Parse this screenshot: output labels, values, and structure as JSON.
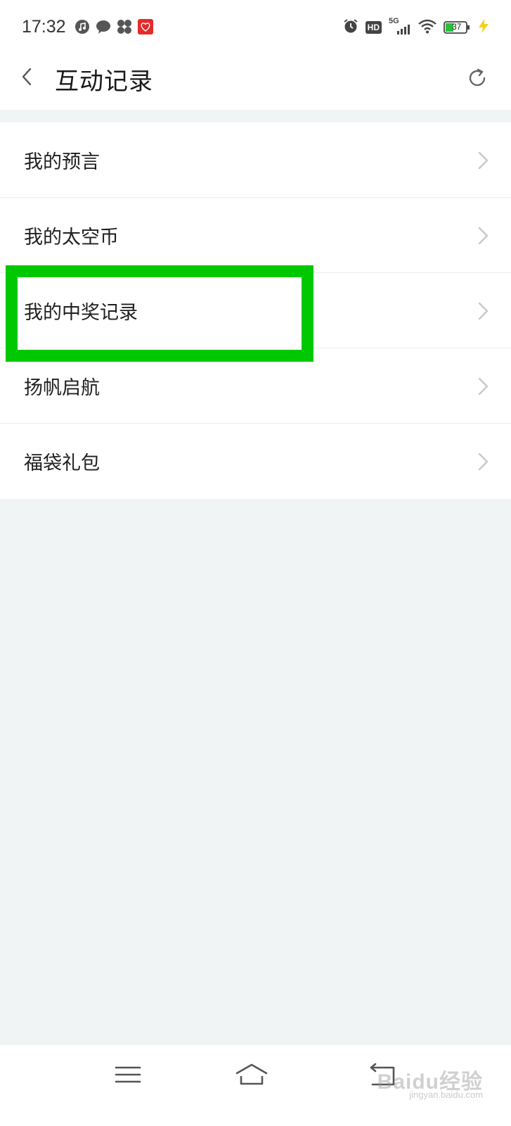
{
  "status_bar": {
    "time": "17:32",
    "notifications": [
      "music-icon",
      "chat-icon",
      "fan-icon",
      "taobao-icon"
    ],
    "system": {
      "alarm": "alarm-icon",
      "hd": "HD",
      "network": "5G",
      "battery_level": "37",
      "charging": true
    }
  },
  "header": {
    "back_icon": "chevron-left-icon",
    "title": "互动记录",
    "refresh_icon": "refresh-icon"
  },
  "menu": {
    "items": [
      {
        "label": "我的预言"
      },
      {
        "label": "我的太空币"
      },
      {
        "label": "我的中奖记录"
      },
      {
        "label": "扬帆启航"
      },
      {
        "label": "福袋礼包"
      }
    ]
  },
  "highlight": {
    "color": "#00c800",
    "target": "我的中奖记录"
  },
  "nav_bar": {
    "menu_icon": "hamburger-icon",
    "home_icon": "home-icon",
    "back_icon": "return-icon"
  },
  "watermark": {
    "text": "Baidu经验",
    "sub": "jingyan.baidu.com"
  }
}
